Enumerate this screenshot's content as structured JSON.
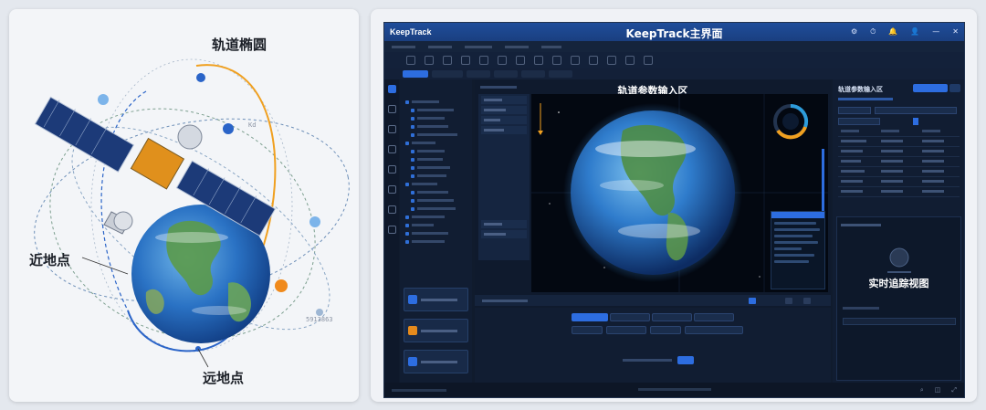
{
  "illustration": {
    "label_orbit": "轨道椭圆",
    "label_perigee": "近地点",
    "label_apogee": "远地点",
    "label_small_right": "Kd",
    "label_small_bottom": "5913863"
  },
  "window": {
    "logo": "KeepTrack",
    "title": "KeepTrack主界面",
    "controls": [
      "⚙",
      "⏱",
      "🔔",
      "👤",
      "—",
      "✕"
    ]
  },
  "main": {
    "center_heading": "轨道参数输入区",
    "right_panel_title": "轨道参数输入区",
    "track_heading": "实时追踪视图"
  },
  "colors": {
    "accent": "#2d6de0",
    "titlebar": "#1f4d9a",
    "orbit_orange": "#f0a020",
    "orbit_blue": "#2a64c8",
    "marker_orange": "#f08a1c"
  }
}
